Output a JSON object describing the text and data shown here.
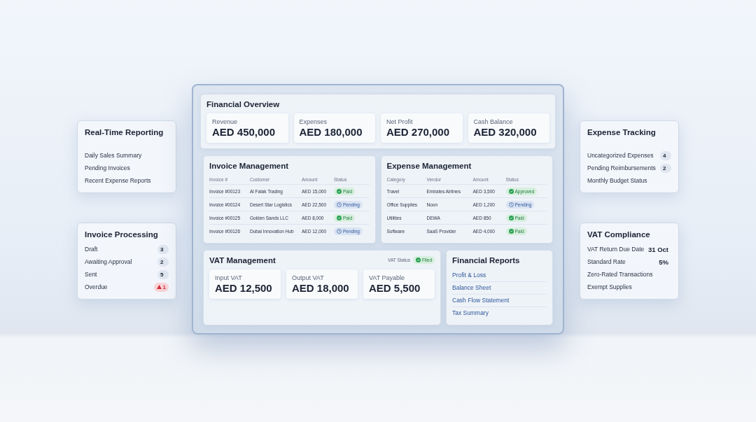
{
  "left_panels": [
    {
      "title": "Real-Time Reporting",
      "spaced": true,
      "items": [
        {
          "label": "Daily Sales Summary"
        },
        {
          "label": "Pending Invoices"
        },
        {
          "label": "Recent Expense Reports"
        }
      ]
    },
    {
      "title": "Invoice Processing",
      "spaced": false,
      "items": [
        {
          "label": "Draft",
          "count": "3",
          "kind": "count"
        },
        {
          "label": "Awaiting Approval",
          "count": "2",
          "kind": "count"
        },
        {
          "label": "Sent",
          "count": "5",
          "kind": "count"
        },
        {
          "label": "Overdue",
          "count": "1",
          "kind": "alert"
        }
      ]
    }
  ],
  "overview": {
    "title": "Financial Overview",
    "metrics": [
      {
        "label": "Revenue",
        "value": "AED 450,000"
      },
      {
        "label": "Expenses",
        "value": "AED 180,000"
      },
      {
        "label": "Net Profit",
        "value": "AED 270,000"
      },
      {
        "label": "Cash Balance",
        "value": "AED 320,000"
      }
    ]
  },
  "tables": [
    {
      "title": "Invoice Management",
      "columns": [
        "Invoice #",
        "Customer",
        "Amount",
        "Status"
      ],
      "rows": [
        {
          "cells": [
            "Invoice #00123",
            "Al Falak Trading",
            "AED 15,000"
          ],
          "status": {
            "label": "Paid",
            "kind": "done"
          }
        },
        {
          "cells": [
            "Invoice #00124",
            "Desert Star Logistics",
            "AED 22,500"
          ],
          "status": {
            "label": "Pending",
            "kind": "pending"
          }
        },
        {
          "cells": [
            "Invoice #00125",
            "Golden Sands LLC",
            "AED 8,000"
          ],
          "status": {
            "label": "Paid",
            "kind": "done"
          }
        },
        {
          "cells": [
            "Invoice #00126",
            "Dubai Innovation Hub",
            "AED 12,000"
          ],
          "status": {
            "label": "Pending",
            "kind": "pending"
          }
        }
      ]
    },
    {
      "title": "Expense Management",
      "columns": [
        "Category",
        "Vendor",
        "Amount",
        "Status"
      ],
      "rows": [
        {
          "cells": [
            "Travel",
            "Emirates Airlines",
            "AED 3,500"
          ],
          "status": {
            "label": "Approved",
            "kind": "done"
          }
        },
        {
          "cells": [
            "Office Supplies",
            "Noon",
            "AED 1,200"
          ],
          "status": {
            "label": "Pending",
            "kind": "pending"
          }
        },
        {
          "cells": [
            "Utilities",
            "DEWA",
            "AED 850"
          ],
          "status": {
            "label": "Paid",
            "kind": "done"
          }
        },
        {
          "cells": [
            "Software",
            "SaaS Provider",
            "AED 4,000"
          ],
          "status": {
            "label": "Paid",
            "kind": "done"
          }
        }
      ]
    }
  ],
  "vat": {
    "title": "VAT Management",
    "status_label": "VAT Status",
    "status": {
      "label": "Filed",
      "kind": "done"
    },
    "metrics": [
      {
        "label": "Input VAT",
        "value": "AED 12,500"
      },
      {
        "label": "Output VAT",
        "value": "AED 18,000"
      },
      {
        "label": "VAT Payable",
        "value": "AED 5,500"
      }
    ]
  },
  "reports": {
    "title": "Financial Reports",
    "links": [
      "Profit & Loss",
      "Balance Sheet",
      "Cash Flow Statement",
      "Tax Summary"
    ]
  },
  "right_panels": [
    {
      "title": "Expense Tracking",
      "spaced": true,
      "items": [
        {
          "label": "Uncategorized Expenses",
          "count": "4",
          "kind": "count"
        },
        {
          "label": "Pending Reimbursements",
          "count": "2",
          "kind": "count"
        },
        {
          "label": "Monthly Budget Status"
        }
      ]
    },
    {
      "title": "VAT Compliance",
      "spaced": false,
      "items": [
        {
          "label": "VAT Return Due Date",
          "count": "31 Oct",
          "kind": "value"
        },
        {
          "label": "Standard Rate",
          "count": "5%",
          "kind": "value"
        },
        {
          "label": "Zero-Rated Transactions"
        },
        {
          "label": "Exempt Supplies"
        }
      ]
    }
  ]
}
